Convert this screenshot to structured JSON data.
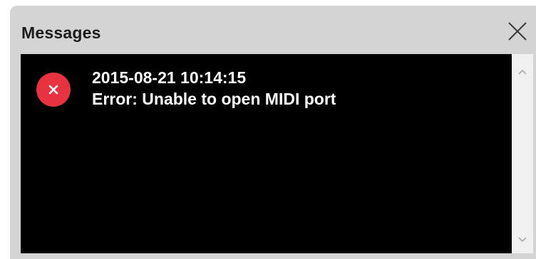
{
  "window": {
    "title": "Messages"
  },
  "messages": [
    {
      "level": "error",
      "icon": "error-circle-icon",
      "timestamp": "2015-08-21 10:14:15",
      "text": "Error: Unable to open MIDI port"
    }
  ],
  "colors": {
    "error_icon": "#e8323f",
    "log_background": "#000000",
    "log_text": "#ffffff",
    "window_background": "#d4d4d4"
  }
}
